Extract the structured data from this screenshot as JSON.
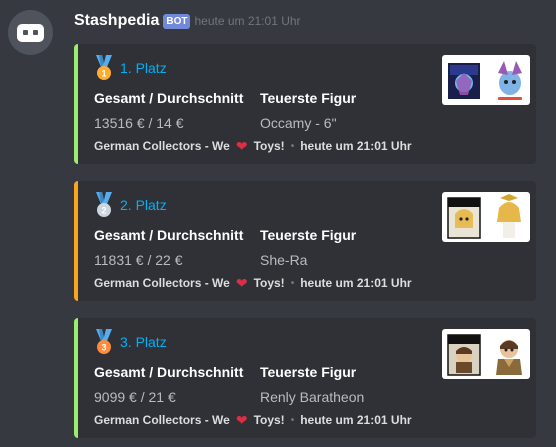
{
  "message": {
    "username": "Stashpedia",
    "bot_tag": "BOT",
    "timestamp": "heute um 21:01 Uhr"
  },
  "embeds": [
    {
      "title": "1. Platz",
      "medal_number": "1",
      "accent_color": "#9cec6e",
      "fields": [
        {
          "name": "Gesamt / Durchschnitt",
          "value": "13516 € / 14 €"
        },
        {
          "name": "Teuerste Figur",
          "value": "Occamy - 6\""
        }
      ],
      "footer": {
        "text_before": "German Collectors - We",
        "text_after": "Toys!",
        "timestamp": "heute um 21:01 Uhr"
      }
    },
    {
      "title": "2. Platz",
      "medal_number": "2",
      "accent_color": "#faa51b",
      "fields": [
        {
          "name": "Gesamt / Durchschnitt",
          "value": "11831 € / 22 €"
        },
        {
          "name": "Teuerste Figur",
          "value": "She-Ra"
        }
      ],
      "footer": {
        "text_before": "German Collectors - We",
        "text_after": "Toys!",
        "timestamp": "heute um 21:01 Uhr"
      }
    },
    {
      "title": "3. Platz",
      "medal_number": "3",
      "accent_color": "#9cec6e",
      "fields": [
        {
          "name": "Gesamt / Durchschnitt",
          "value": "9099 € / 21 €"
        },
        {
          "name": "Teuerste Figur",
          "value": "Renly Baratheon"
        }
      ],
      "footer": {
        "text_before": "German Collectors - We",
        "text_after": "Toys!",
        "timestamp": "heute um 21:01 Uhr"
      }
    }
  ],
  "icons": {
    "avatar": "robot-face-icon",
    "medal": "medal-icon",
    "heart": "heart-icon",
    "thumbnail": "funko-pop-figure-image"
  }
}
